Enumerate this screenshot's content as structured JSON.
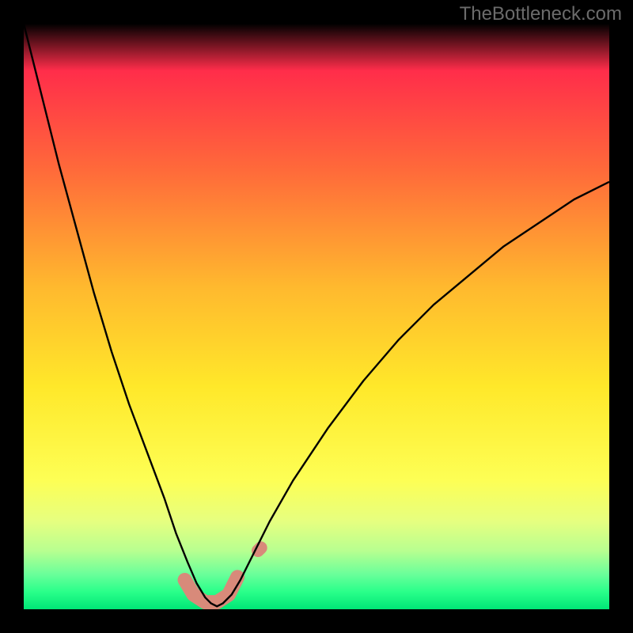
{
  "watermark": "TheBottleneck.com",
  "chart_data": {
    "type": "line",
    "title": "",
    "xlabel": "",
    "ylabel": "",
    "xlim": [
      0,
      100
    ],
    "ylim": [
      0,
      100
    ],
    "gradient_stops": [
      {
        "offset": 0.0,
        "color": "#ff1а4f"
      },
      {
        "offset": 0.08,
        "color": "#ff2d4a"
      },
      {
        "offset": 0.25,
        "color": "#ff6a3a"
      },
      {
        "offset": 0.45,
        "color": "#ffb92e"
      },
      {
        "offset": 0.62,
        "color": "#ffe82a"
      },
      {
        "offset": 0.78,
        "color": "#fdff55"
      },
      {
        "offset": 0.85,
        "color": "#e6ff80"
      },
      {
        "offset": 0.9,
        "color": "#b8ff90"
      },
      {
        "offset": 0.94,
        "color": "#6aff9a"
      },
      {
        "offset": 0.97,
        "color": "#2aff8a"
      },
      {
        "offset": 1.0,
        "color": "#00e676"
      }
    ],
    "series": [
      {
        "name": "curve",
        "stroke": "#000000",
        "stroke_width": 2.4,
        "x": [
          0,
          3,
          6,
          9,
          12,
          15,
          18,
          21,
          24,
          26,
          28,
          29.5,
          31,
          32,
          33,
          34,
          35.5,
          37,
          39,
          42,
          46,
          52,
          58,
          64,
          70,
          76,
          82,
          88,
          94,
          100
        ],
        "y": [
          100,
          88,
          76,
          65,
          54,
          44,
          35,
          27,
          19,
          13,
          8,
          4.5,
          2,
          1,
          0.5,
          1,
          2.5,
          5,
          9,
          15,
          22,
          31,
          39,
          46,
          52,
          57,
          62,
          66,
          70,
          73
        ]
      },
      {
        "name": "marker-band",
        "stroke": "#d88a7a",
        "stroke_width": 18,
        "linecap": "round",
        "x": [
          27.5,
          29,
          31,
          33,
          35,
          36.5
        ],
        "y": [
          5,
          2.5,
          1.2,
          1.2,
          2.5,
          5.5
        ]
      },
      {
        "name": "marker-dot",
        "stroke": "#d88a7a",
        "fill": "#d88a7a",
        "stroke_width": 16,
        "linecap": "round",
        "x": [
          40,
          40.5
        ],
        "y": [
          10,
          10.5
        ]
      }
    ]
  }
}
